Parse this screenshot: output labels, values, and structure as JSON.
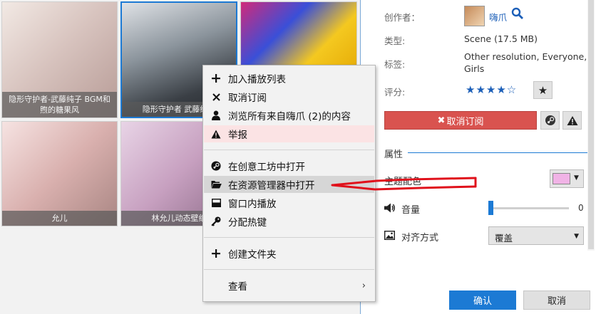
{
  "wallpapers": [
    {
      "caption": "隐形守护者-武藤纯子 BGM和煦的糖果风",
      "selected": false
    },
    {
      "caption": "隐形守护者 武藤纯子",
      "selected": true
    },
    {
      "caption": "",
      "selected": false
    },
    {
      "caption": "允儿",
      "selected": false
    },
    {
      "caption": "林允儿动态壁纸",
      "selected": false
    },
    {
      "caption": "",
      "selected": false
    }
  ],
  "details": {
    "author_label": "创作者：",
    "author_name": "嗨爪",
    "type_label": "类型:",
    "type_value": "Scene (17.5 MB)",
    "tags_label": "标签:",
    "tags_value_line1": "Other resolution, Everyone,",
    "tags_value_line2": "Girls",
    "rating_label": "评分:",
    "stars_display": "★★★★☆",
    "rating_value": 4,
    "unsubscribe_label": "取消订阅",
    "properties_title": "属性",
    "theme_color_label": "主题配色",
    "theme_color": "#f1b3e6",
    "volume_label": "音量",
    "volume_value": "0",
    "align_label": "对齐方式",
    "align_value": "覆盖"
  },
  "buttons": {
    "ok": "确认",
    "cancel": "取消"
  },
  "context_menu": {
    "add_playlist": "加入播放列表",
    "unsubscribe": "取消订阅",
    "browse_author": "浏览所有来自嗨爪 (2)的内容",
    "report": "举报",
    "open_workshop": "在创意工坊中打开",
    "open_explorer": "在资源管理器中打开",
    "play_window": "窗口内播放",
    "assign_hotkey": "分配热键",
    "create_folder": "创建文件夹",
    "view": "查看"
  },
  "colors": {
    "accent": "#1c7ad4",
    "danger": "#d9534f",
    "annotation": "#e0111b"
  }
}
